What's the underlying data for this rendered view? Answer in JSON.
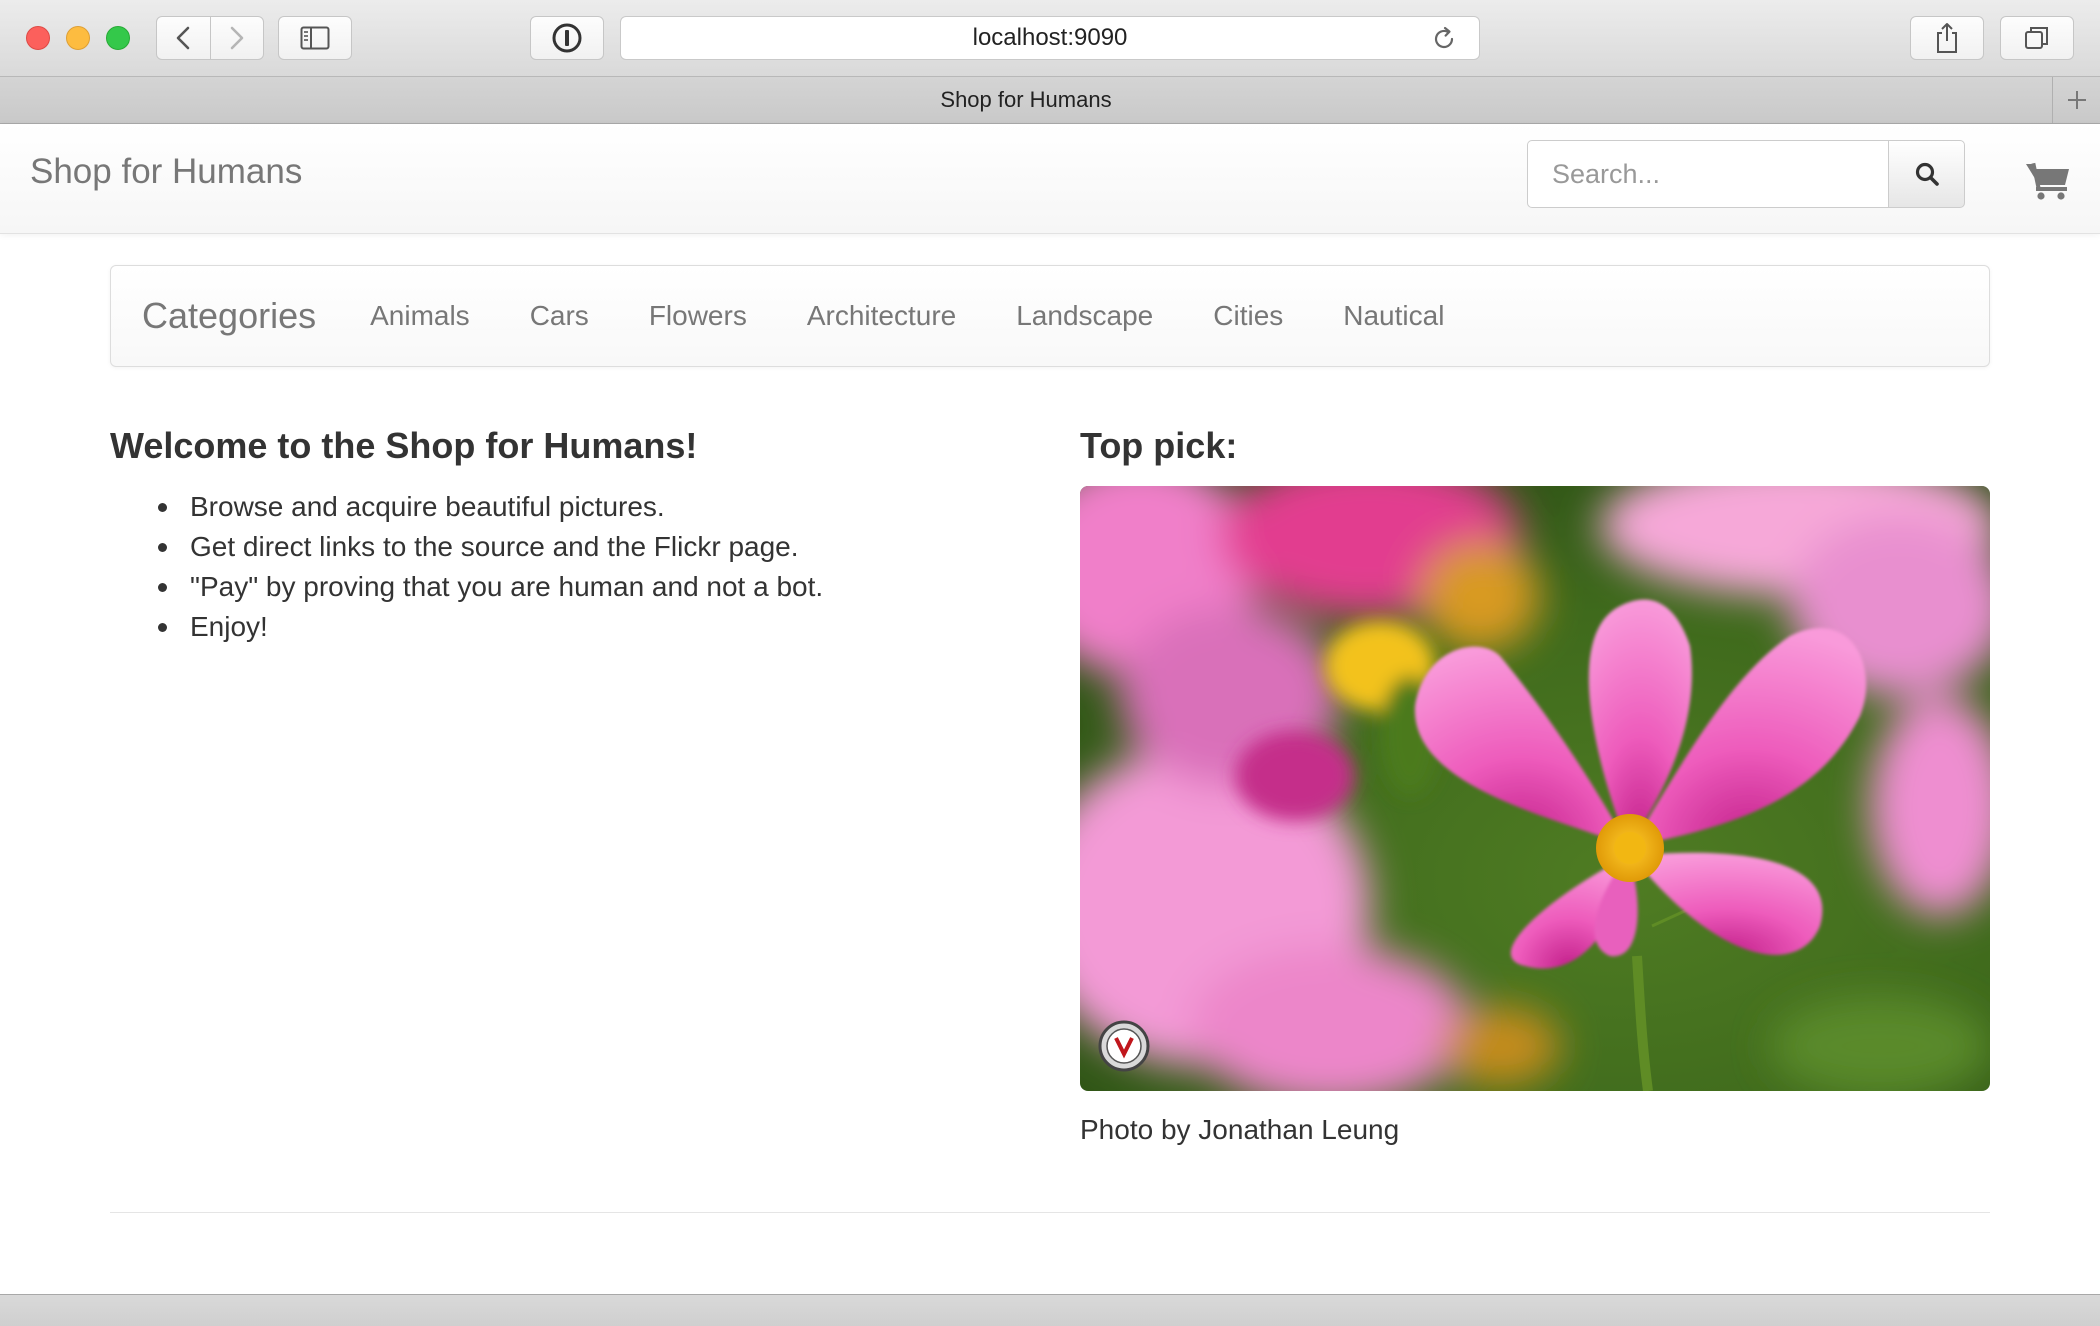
{
  "browser": {
    "url": "localhost:9090",
    "tab_title": "Shop for Humans",
    "traffic_colors": {
      "close": "#fc605c",
      "minimize": "#fdbc40",
      "zoom": "#34c84a"
    }
  },
  "navbar": {
    "brand": "Shop for Humans",
    "search_placeholder": "Search...",
    "search_icon": "search-icon",
    "cart_icon": "shopping-cart-icon"
  },
  "categories": {
    "heading": "Categories",
    "items": [
      "Animals",
      "Cars",
      "Flowers",
      "Architecture",
      "Landscape",
      "Cities",
      "Nautical"
    ]
  },
  "welcome": {
    "title": "Welcome to the Shop for Humans!",
    "points": [
      "Browse and acquire beautiful pictures.",
      "Get direct links to the source and the Flickr page.",
      "\"Pay\" by proving that you are human and not a bot.",
      "Enjoy!"
    ]
  },
  "top_pick": {
    "title": "Top pick:",
    "caption": "Photo by Jonathan Leung"
  }
}
